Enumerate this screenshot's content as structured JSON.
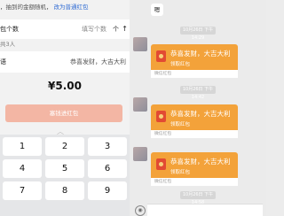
{
  "left": {
    "top_note": "，抽到的金额随机，",
    "top_link": "改为普通红包",
    "count_row": {
      "label": "包个数",
      "placeholder": "填写个数",
      "unit": "个"
    },
    "group_size": "共3人",
    "greeting_row": {
      "label": "语",
      "value": "恭喜发财，大吉大利"
    },
    "amount": "¥5.00",
    "send_button": "塞钱进红包",
    "keypad": [
      "1",
      "2",
      "3",
      "4",
      "5",
      "6",
      "7",
      "8",
      "9"
    ]
  },
  "right": {
    "first_message": "嗯",
    "timestamps": [
      "10月26日 下午14:29",
      "10月26日 下午14:42",
      "10月26日 下午14:58"
    ],
    "packets": [
      {
        "title": "恭喜发财，大吉大利",
        "sub": "领取红包",
        "footer": "微信红包"
      },
      {
        "title": "恭喜发财，大吉大利",
        "sub": "领取红包",
        "footer": "微信红包"
      },
      {
        "title": "恭喜发财，大吉大利",
        "sub": "领取红包",
        "footer": "微信红包"
      }
    ]
  },
  "colors": {
    "packet": "#f3a23a",
    "send_button": "#f3b6a4",
    "link": "#2f6bd3"
  }
}
